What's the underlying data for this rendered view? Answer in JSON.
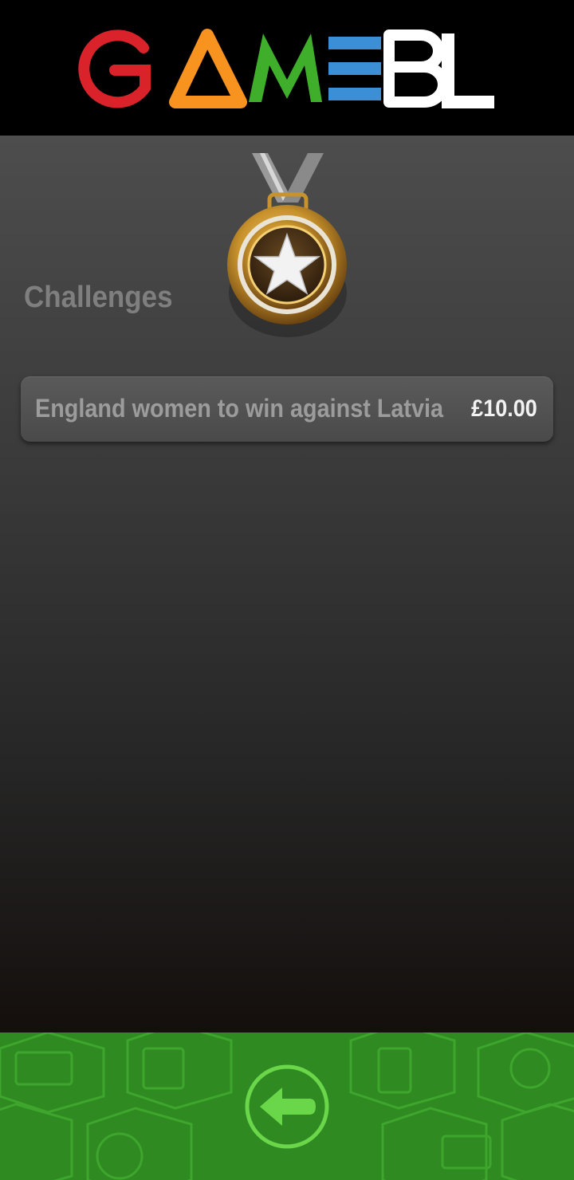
{
  "header": {
    "logo_letters": [
      "G",
      "A",
      "M",
      "E",
      "B",
      "L"
    ],
    "logo_colors": [
      "#d9222a",
      "#f7931e",
      "#3fae2a",
      "#3a8fd6",
      "#ffffff",
      "#ffffff"
    ]
  },
  "main": {
    "section_title": "Challenges",
    "challenges": [
      {
        "label": "England women to win against Latvia",
        "amount": "£10.00"
      }
    ]
  },
  "footer": {
    "back_icon": "arrow-left-icon"
  }
}
